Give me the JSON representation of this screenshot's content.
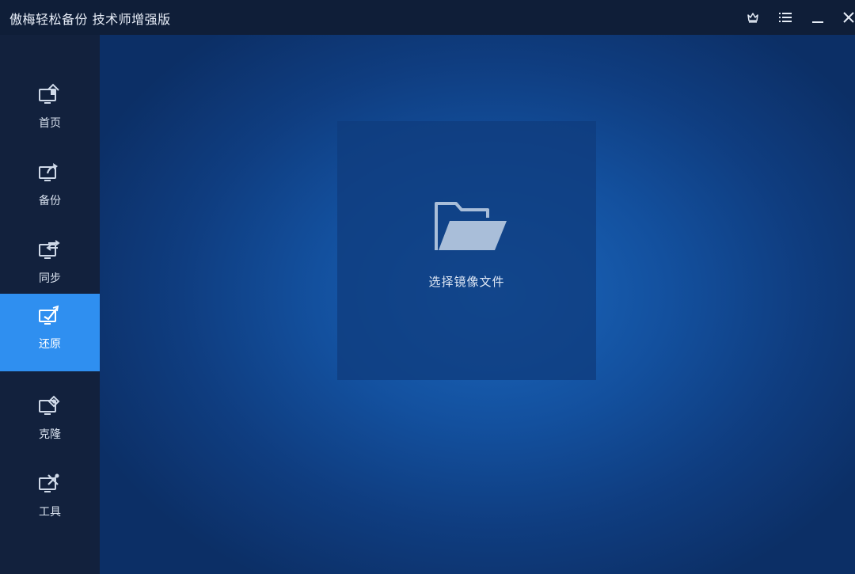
{
  "window": {
    "title": "傲梅轻松备份 技术师增强版"
  },
  "titlebar_icons": [
    "crown-icon",
    "menu-icon",
    "minimize-icon",
    "close-icon"
  ],
  "sidebar": {
    "items": [
      {
        "label": "首页",
        "icon": "monitor-home-icon",
        "active": false
      },
      {
        "label": "备份",
        "icon": "monitor-export-icon",
        "active": false
      },
      {
        "label": "同步",
        "icon": "monitor-sync-icon",
        "active": false
      },
      {
        "label": "还原",
        "icon": "monitor-restore-icon",
        "active": true
      },
      {
        "label": "克隆",
        "icon": "monitor-clone-icon",
        "active": false
      },
      {
        "label": "工具",
        "icon": "monitor-tools-icon",
        "active": false
      }
    ]
  },
  "main": {
    "select_image": {
      "label": "选择镜像文件",
      "icon": "folder-open-icon"
    }
  },
  "colors": {
    "active_nav": "#2f8ff0",
    "sidebar_bg": "#12213d",
    "titlebar_bg": "#0f1e38",
    "main_bg": "#1b67bd"
  }
}
